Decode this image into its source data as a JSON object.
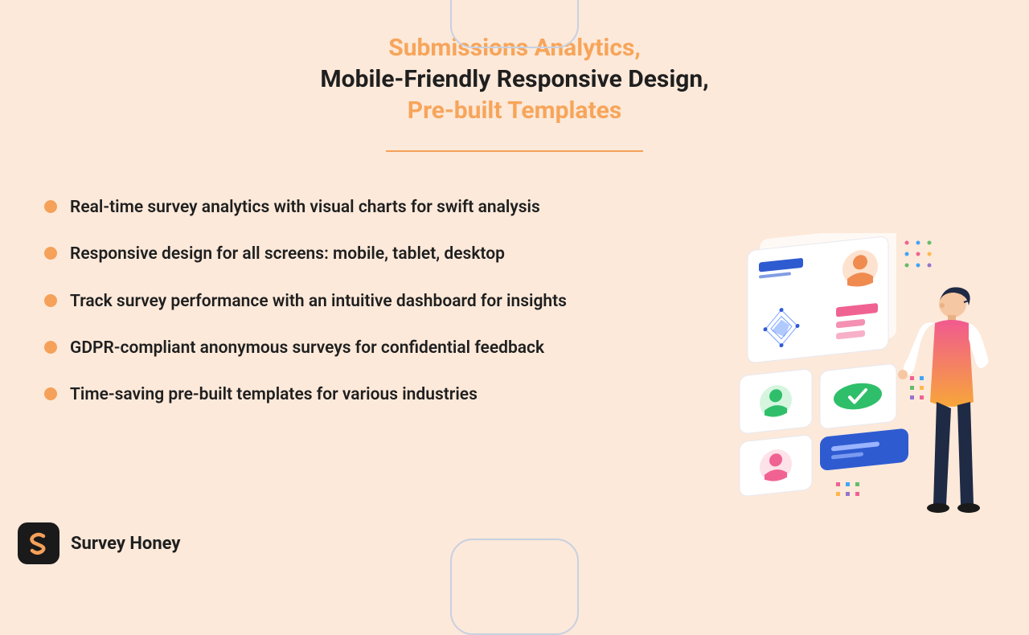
{
  "header": {
    "line1": "Submissions Analytics,",
    "line2": "Mobile-Friendly Responsive Design,",
    "line3": "Pre-built Templates"
  },
  "divider_color": "#f5a15a",
  "bullet_color": "#f5a15a",
  "features": [
    "Real-time survey analytics with visual charts for swift analysis",
    "Responsive design for all screens: mobile, tablet, desktop",
    "Track survey performance with an intuitive dashboard for insights",
    "GDPR-compliant anonymous surveys for confidential feedback",
    "Time-saving pre-built templates for various industries"
  ],
  "brand": {
    "name": "Survey Honey",
    "logo_bg": "#1a1a1a",
    "logo_fg": "#f5a15a"
  }
}
